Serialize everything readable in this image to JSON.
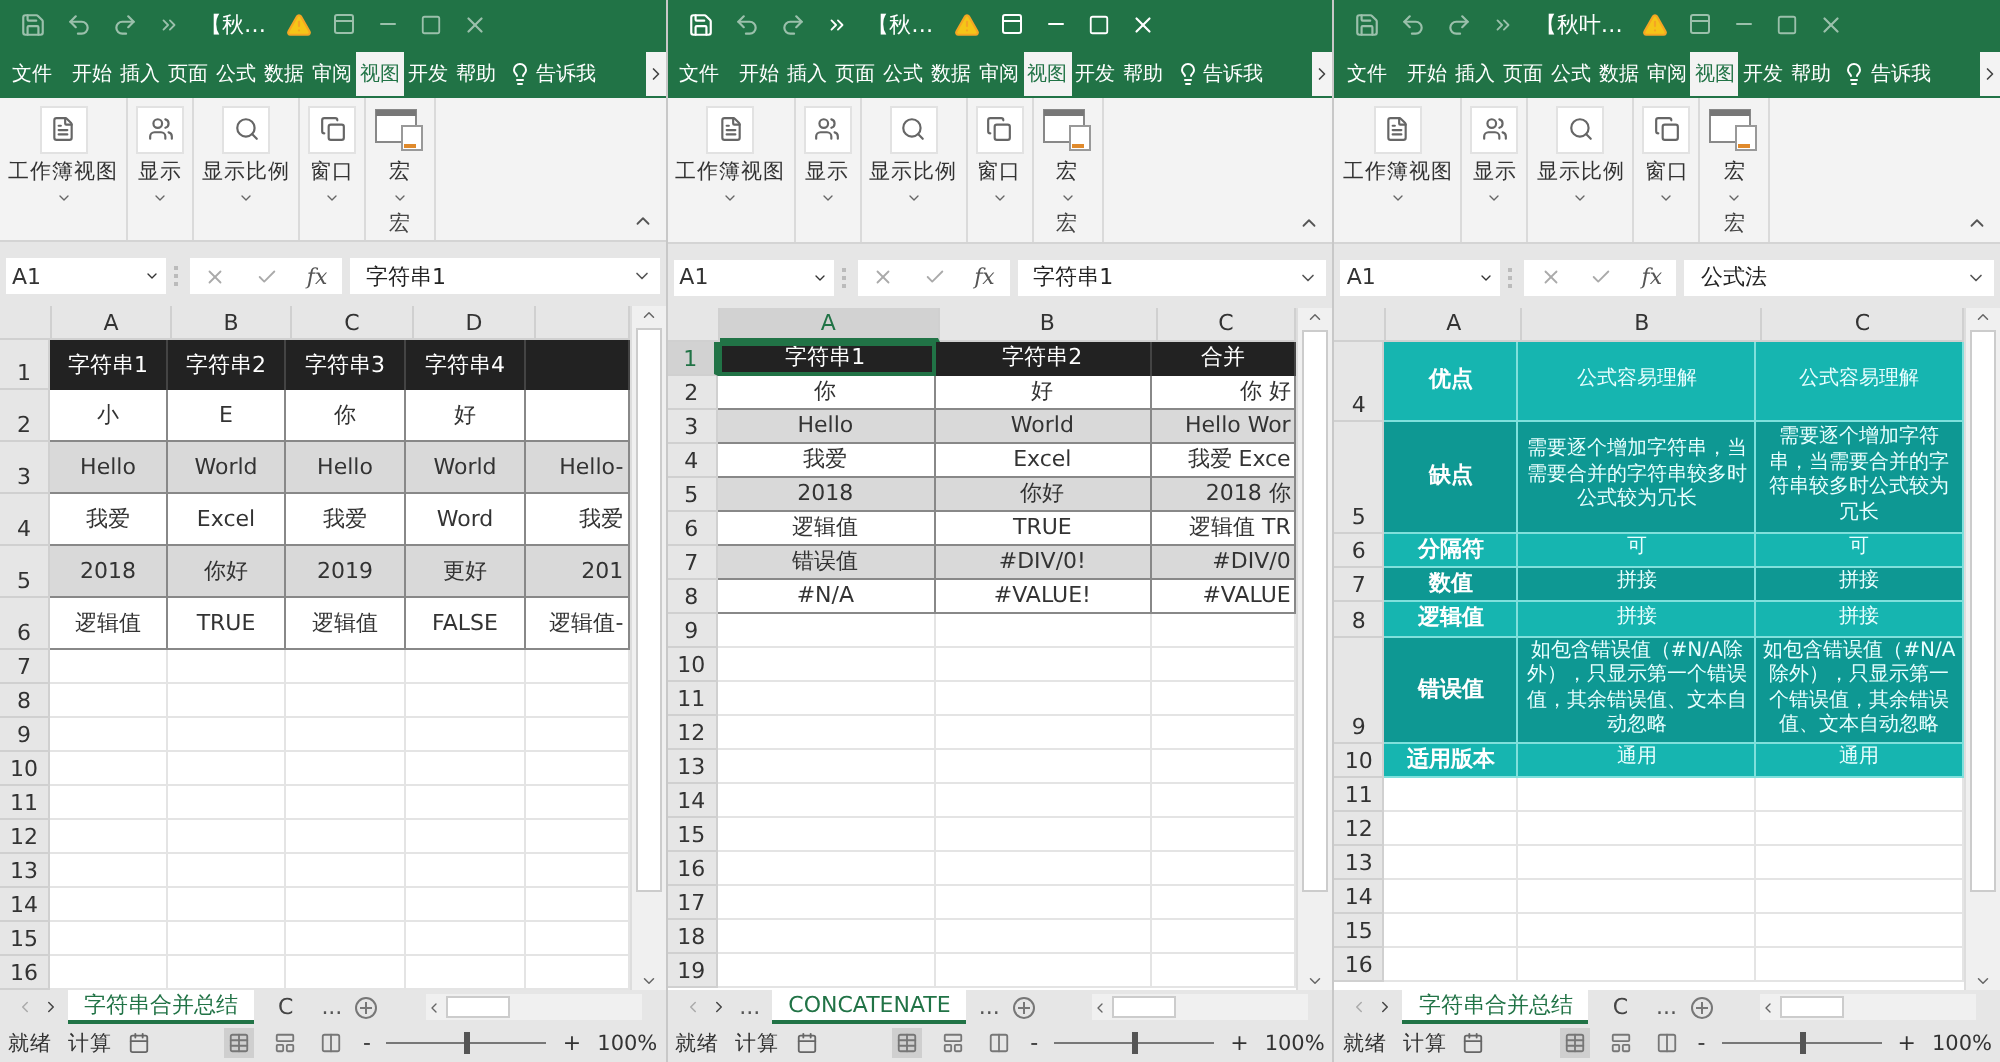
{
  "windows": [
    {
      "active": false,
      "title": "【秋…",
      "ribbon_tabs": [
        {
          "label": "文件",
          "selected": false
        },
        {
          "label": "开始",
          "selected": false
        },
        {
          "label": "插入",
          "selected": false
        },
        {
          "label": "页面",
          "selected": false
        },
        {
          "label": "公式",
          "selected": false
        },
        {
          "label": "数据",
          "selected": false
        },
        {
          "label": "审阅",
          "selected": false
        },
        {
          "label": "视图",
          "selected": true
        },
        {
          "label": "开发",
          "selected": false
        },
        {
          "label": "帮助",
          "selected": false
        }
      ],
      "tell_me": "告诉我",
      "ribbon_groups": [
        {
          "label": "工作簿视图",
          "kind": "doc"
        },
        {
          "label": "显示",
          "kind": "show"
        },
        {
          "label": "显示比例",
          "kind": "zoom"
        },
        {
          "label": "窗口",
          "kind": "window"
        },
        {
          "label": "宏",
          "kind": "macro",
          "group_label": "宏"
        }
      ],
      "name_box": "A1",
      "fx": "fx",
      "formula": "字符串1",
      "columns": [
        {
          "label": "A",
          "selected": false
        },
        {
          "label": "B",
          "selected": false
        },
        {
          "label": "C",
          "selected": false
        },
        {
          "label": "D",
          "selected": false
        }
      ],
      "rows": [
        {
          "number": "1",
          "selected": false,
          "cells": [
            {
              "text": "字符串1",
              "kind": "header"
            },
            {
              "text": "字符串2",
              "kind": "header"
            },
            {
              "text": "字符串3",
              "kind": "header"
            },
            {
              "text": "字符串4",
              "kind": "header"
            },
            {
              "kind": "header"
            }
          ]
        },
        {
          "number": "2",
          "selected": false,
          "cells": [
            {
              "text": "小",
              "kind": "plain"
            },
            {
              "text": "E",
              "kind": "plain"
            },
            {
              "text": "你",
              "kind": "plain"
            },
            {
              "text": "好",
              "kind": "plain"
            },
            {
              "kind": "plain"
            }
          ]
        },
        {
          "number": "3",
          "selected": false,
          "cells": [
            {
              "text": "Hello",
              "kind": "band"
            },
            {
              "text": "World",
              "kind": "band"
            },
            {
              "text": "Hello",
              "kind": "band"
            },
            {
              "text": "World",
              "kind": "band"
            },
            {
              "text": "Hello-",
              "kind": "band",
              "clipped": true
            }
          ]
        },
        {
          "number": "4",
          "selected": false,
          "cells": [
            {
              "text": "我爱",
              "kind": "plain"
            },
            {
              "text": "Excel",
              "kind": "plain"
            },
            {
              "text": "我爱",
              "kind": "plain"
            },
            {
              "text": "Word",
              "kind": "plain"
            },
            {
              "text": "我爱",
              "kind": "plain",
              "clipped": true
            }
          ]
        },
        {
          "number": "5",
          "selected": false,
          "cells": [
            {
              "text": "2018",
              "kind": "band"
            },
            {
              "text": "你好",
              "kind": "band"
            },
            {
              "text": "2019",
              "kind": "band"
            },
            {
              "text": "更好",
              "kind": "band"
            },
            {
              "text": "201",
              "kind": "band",
              "clipped": true
            }
          ]
        },
        {
          "number": "6",
          "selected": false,
          "cells": [
            {
              "text": "逻辑值",
              "kind": "plain"
            },
            {
              "text": "TRUE",
              "kind": "plain"
            },
            {
              "text": "逻辑值",
              "kind": "plain"
            },
            {
              "text": "FALSE",
              "kind": "plain"
            },
            {
              "text": "逻辑值-",
              "kind": "plain",
              "clipped": true
            }
          ]
        },
        {
          "number": "7",
          "selected": false
        },
        {
          "number": "8",
          "selected": false
        },
        {
          "number": "9",
          "selected": false
        },
        {
          "number": "10",
          "selected": false
        },
        {
          "number": "11",
          "selected": false
        },
        {
          "number": "12",
          "selected": false
        },
        {
          "number": "13",
          "selected": false
        },
        {
          "number": "14",
          "selected": false
        },
        {
          "number": "15",
          "selected": false
        },
        {
          "number": "16",
          "selected": false
        }
      ],
      "sheet_tabs": [
        {
          "label": "字符串合并总结",
          "kind": "sheet",
          "selected": true
        },
        {
          "label": "C",
          "kind": "sheet",
          "selected": false
        },
        {
          "label": "...",
          "kind": "more",
          "selected": false
        }
      ],
      "status": {
        "ready": "就绪",
        "calc": "计算",
        "zoom_out": "-",
        "zoom_in": "+",
        "zoom": "100%",
        "zoom_slider": {
          "level": 0.5
        }
      }
    },
    {
      "active": true,
      "title": "【秋…",
      "ribbon_tabs": [
        {
          "label": "文件",
          "selected": false
        },
        {
          "label": "开始",
          "selected": false
        },
        {
          "label": "插入",
          "selected": false
        },
        {
          "label": "页面",
          "selected": false
        },
        {
          "label": "公式",
          "selected": false
        },
        {
          "label": "数据",
          "selected": false
        },
        {
          "label": "审阅",
          "selected": false
        },
        {
          "label": "视图",
          "selected": true
        },
        {
          "label": "开发",
          "selected": false
        },
        {
          "label": "帮助",
          "selected": false
        }
      ],
      "tell_me": "告诉我",
      "ribbon_groups": [
        {
          "label": "工作簿视图",
          "kind": "doc"
        },
        {
          "label": "显示",
          "kind": "show"
        },
        {
          "label": "显示比例",
          "kind": "zoom"
        },
        {
          "label": "窗口",
          "kind": "window"
        },
        {
          "label": "宏",
          "kind": "macro",
          "group_label": "宏"
        }
      ],
      "name_box": "A1",
      "fx": "fx",
      "formula": "字符串1",
      "columns": [
        {
          "label": "A",
          "selected": true
        },
        {
          "label": "B",
          "selected": false
        },
        {
          "label": "C",
          "selected": false
        }
      ],
      "rows": [
        {
          "number": "1",
          "selected": true,
          "cells": [
            {
              "text": "字符串1",
              "kind": "header"
            },
            {
              "text": "字符串2",
              "kind": "header"
            },
            {
              "text": "合并",
              "kind": "header"
            }
          ]
        },
        {
          "number": "2",
          "selected": false,
          "cells": [
            {
              "text": "你",
              "kind": "plain"
            },
            {
              "text": "好",
              "kind": "plain"
            },
            {
              "text": "你 好",
              "kind": "plain",
              "clipped": true
            }
          ]
        },
        {
          "number": "3",
          "selected": false,
          "cells": [
            {
              "text": "Hello",
              "kind": "band"
            },
            {
              "text": "World",
              "kind": "band"
            },
            {
              "text": "Hello Wor",
              "kind": "band",
              "clipped": true
            }
          ]
        },
        {
          "number": "4",
          "selected": false,
          "cells": [
            {
              "text": "我爱",
              "kind": "plain"
            },
            {
              "text": "Excel",
              "kind": "plain"
            },
            {
              "text": "我爱 Exce",
              "kind": "plain",
              "clipped": true
            }
          ]
        },
        {
          "number": "5",
          "selected": false,
          "cells": [
            {
              "text": "2018",
              "kind": "band"
            },
            {
              "text": "你好",
              "kind": "band"
            },
            {
              "text": "2018 你",
              "kind": "band",
              "clipped": true
            }
          ]
        },
        {
          "number": "6",
          "selected": false,
          "cells": [
            {
              "text": "逻辑值",
              "kind": "plain"
            },
            {
              "text": "TRUE",
              "kind": "plain"
            },
            {
              "text": "逻辑值 TR",
              "kind": "plain",
              "clipped": true
            }
          ]
        },
        {
          "number": "7",
          "selected": false,
          "cells": [
            {
              "text": "错误值",
              "kind": "band"
            },
            {
              "text": "#DIV/0!",
              "kind": "band"
            },
            {
              "text": "#DIV/0",
              "kind": "band",
              "clipped": true
            }
          ]
        },
        {
          "number": "8",
          "selected": false,
          "cells": [
            {
              "text": "#N/A",
              "kind": "plain"
            },
            {
              "text": "#VALUE!",
              "kind": "plain"
            },
            {
              "text": "#VALUE",
              "kind": "plain",
              "clipped": true
            }
          ]
        },
        {
          "number": "9",
          "selected": false
        },
        {
          "number": "10",
          "selected": false
        },
        {
          "number": "11",
          "selected": false
        },
        {
          "number": "12",
          "selected": false
        },
        {
          "number": "13",
          "selected": false
        },
        {
          "number": "14",
          "selected": false
        },
        {
          "number": "15",
          "selected": false
        },
        {
          "number": "16",
          "selected": false
        },
        {
          "number": "17",
          "selected": false
        },
        {
          "number": "18",
          "selected": false
        },
        {
          "number": "19",
          "selected": false
        }
      ],
      "sheet_tabs": [
        {
          "label": "...",
          "kind": "more",
          "selected": false
        },
        {
          "label": "CONCATENATE",
          "kind": "sheet",
          "selected": true
        },
        {
          "label": "...",
          "kind": "more",
          "selected": false
        }
      ],
      "status": {
        "ready": "就绪",
        "calc": "计算",
        "zoom_out": "-",
        "zoom_in": "+",
        "zoom": "100%",
        "zoom_slider": {
          "level": 0.5
        }
      }
    },
    {
      "active": false,
      "title": "【秋叶…",
      "ribbon_tabs": [
        {
          "label": "文件",
          "selected": false
        },
        {
          "label": "开始",
          "selected": false
        },
        {
          "label": "插入",
          "selected": false
        },
        {
          "label": "页面",
          "selected": false
        },
        {
          "label": "公式",
          "selected": false
        },
        {
          "label": "数据",
          "selected": false
        },
        {
          "label": "审阅",
          "selected": false
        },
        {
          "label": "视图",
          "selected": true
        },
        {
          "label": "开发",
          "selected": false
        },
        {
          "label": "帮助",
          "selected": false
        }
      ],
      "tell_me": "告诉我",
      "ribbon_groups": [
        {
          "label": "工作簿视图",
          "kind": "doc"
        },
        {
          "label": "显示",
          "kind": "show"
        },
        {
          "label": "显示比例",
          "kind": "zoom"
        },
        {
          "label": "窗口",
          "kind": "window"
        },
        {
          "label": "宏",
          "kind": "macro",
          "group_label": "宏"
        }
      ],
      "name_box": "A1",
      "fx": "fx",
      "formula": "公式法",
      "columns": [
        {
          "label": "A",
          "selected": false
        },
        {
          "label": "B",
          "selected": false
        },
        {
          "label": "C",
          "selected": false
        }
      ],
      "rows": [
        {
          "number": "4",
          "selected": false,
          "cells": [
            {
              "text": "优点",
              "kind": "teal_head"
            },
            {
              "text": "公式容易理解",
              "kind": "teal"
            },
            {
              "text": "公式容易理解",
              "kind": "teal"
            }
          ]
        },
        {
          "number": "5",
          "selected": false,
          "cells": [
            {
              "text": "缺点",
              "kind": "teal_dark_head"
            },
            {
              "text": "需要逐个增加字符串，当需要合并的字符串较多时公式较为冗长",
              "kind": "teal_dark"
            },
            {
              "text": "需要逐个增加字符串，当需要合并的字符串较多时公式较为冗长",
              "kind": "teal_dark"
            }
          ]
        },
        {
          "number": "6",
          "selected": false,
          "cells": [
            {
              "text": "分隔符",
              "kind": "teal_head"
            },
            {
              "text": "可",
              "kind": "teal"
            },
            {
              "text": "可",
              "kind": "teal"
            }
          ]
        },
        {
          "number": "7",
          "selected": false,
          "cells": [
            {
              "text": "数值",
              "kind": "teal_dark_head"
            },
            {
              "text": "拼接",
              "kind": "teal_dark"
            },
            {
              "text": "拼接",
              "kind": "teal_dark"
            }
          ]
        },
        {
          "number": "8",
          "selected": false,
          "cells": [
            {
              "text": "逻辑值",
              "kind": "teal_head"
            },
            {
              "text": "拼接",
              "kind": "teal"
            },
            {
              "text": "拼接",
              "kind": "teal"
            }
          ]
        },
        {
          "number": "9",
          "selected": false,
          "cells": [
            {
              "text": "错误值",
              "kind": "teal_dark_head"
            },
            {
              "text": "如包含错误值（#N/A除外），只显示第一个错误值，其余错误值、文本自动忽略",
              "kind": "teal_dark"
            },
            {
              "text": "如包含错误值（#N/A除外），只显示第一个错误值，其余错误值、文本自动忽略",
              "kind": "teal_dark"
            }
          ]
        },
        {
          "number": "10",
          "selected": false,
          "cells": [
            {
              "text": "适用版本",
              "kind": "teal_head"
            },
            {
              "text": "通用",
              "kind": "teal"
            },
            {
              "text": "通用",
              "kind": "teal"
            }
          ]
        },
        {
          "number": "11",
          "selected": false
        },
        {
          "number": "12",
          "selected": false
        },
        {
          "number": "13",
          "selected": false
        },
        {
          "number": "14",
          "selected": false
        },
        {
          "number": "15",
          "selected": false
        },
        {
          "number": "16",
          "selected": false
        }
      ],
      "sheet_tabs": [
        {
          "label": "字符串合并总结",
          "kind": "sheet",
          "selected": true
        },
        {
          "label": "C",
          "kind": "sheet",
          "selected": false
        },
        {
          "label": "...",
          "kind": "more",
          "selected": false
        }
      ],
      "status": {
        "ready": "就绪",
        "calc": "计算",
        "zoom_out": "-",
        "zoom_in": "+",
        "zoom": "100%",
        "zoom_slider": {
          "level": 0.5
        }
      }
    }
  ]
}
